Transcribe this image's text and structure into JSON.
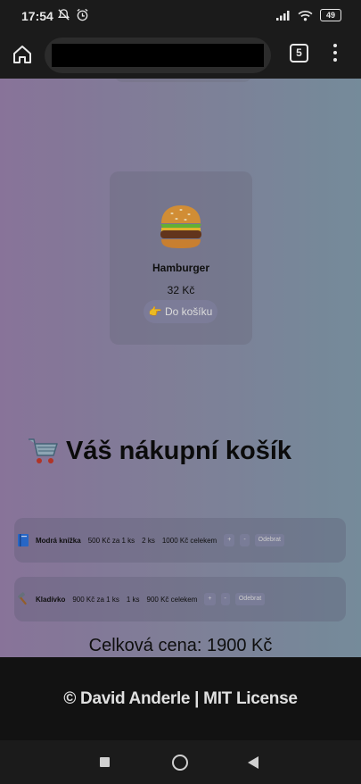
{
  "status_bar": {
    "time": "17:54",
    "battery": "49",
    "icons_left": [
      "mute-notification-icon",
      "alarm-icon"
    ],
    "icons_right": [
      "signal-icon",
      "wifi-icon",
      "battery-icon"
    ]
  },
  "browser": {
    "url": "",
    "tab_count": "5",
    "icons": [
      "home-icon",
      "more-vert-icon"
    ]
  },
  "product": {
    "emoji": "🍔",
    "name": "Hamburger",
    "price": "32 Kč",
    "add_button": "👉 Do košíku"
  },
  "cart": {
    "title": "Váš nákupní košík",
    "title_icon": "shopping-cart-icon",
    "items": [
      {
        "icon": "blue-book-icon",
        "name": "Modrá knížka",
        "unit_price": "500 Kč za 1 ks",
        "quantity": "2 ks",
        "line_total": "1000 Kč celekem",
        "plus": "+",
        "minus": "-",
        "remove": "Odebrat"
      },
      {
        "icon": "hammer-icon",
        "name": "Kladívko",
        "unit_price": "900 Kč za 1 ks",
        "quantity": "1 ks",
        "line_total": "900 Kč celekem",
        "plus": "+",
        "minus": "-",
        "remove": "Odebrat"
      }
    ],
    "total": "Celková cena: 1900 Kč"
  },
  "footer": {
    "text": "© David Anderle | MIT License"
  },
  "nav": {
    "icons": [
      "recents-square-icon",
      "home-circle-icon",
      "back-triangle-icon"
    ]
  }
}
